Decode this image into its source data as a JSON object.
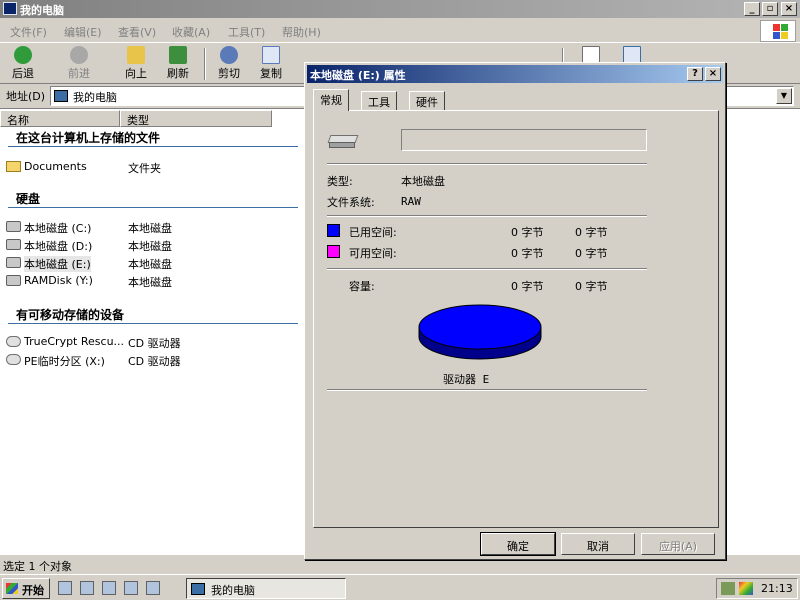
{
  "window": {
    "title": "我的电脑"
  },
  "menu": [
    "文件(F)",
    "编辑(E)",
    "查看(V)",
    "收藏(A)",
    "工具(T)",
    "帮助(H)"
  ],
  "toolbar": {
    "back": "后退",
    "forward": "前进",
    "up": "向上",
    "refresh": "刷新",
    "cut": "剪切",
    "copy": "复制"
  },
  "address": {
    "label": "地址(D)",
    "value": "我的电脑"
  },
  "list": {
    "columns": [
      "名称",
      "类型"
    ],
    "groups": [
      {
        "title": "在这台计算机上存储的文件",
        "items": [
          {
            "name": "Documents",
            "type": "文件夹",
            "icon": "folder-icon"
          }
        ]
      },
      {
        "title": "硬盘",
        "items": [
          {
            "name": "本地磁盘 (C:)",
            "type": "本地磁盘",
            "icon": "hard-disk-icon"
          },
          {
            "name": "本地磁盘 (D:)",
            "type": "本地磁盘",
            "icon": "hard-disk-icon"
          },
          {
            "name": "本地磁盘 (E:)",
            "type": "本地磁盘",
            "icon": "hard-disk-icon"
          },
          {
            "name": "RAMDisk (Y:)",
            "type": "本地磁盘",
            "icon": "hard-disk-icon"
          }
        ]
      },
      {
        "title": "有可移动存储的设备",
        "items": [
          {
            "name": "TrueCrypt Rescu...",
            "type": "CD 驱动器",
            "icon": "cd-drive-icon"
          },
          {
            "name": "PE临时分区 (X:)",
            "type": "CD 驱动器",
            "icon": "cd-drive-icon"
          }
        ]
      }
    ]
  },
  "status": {
    "text": "选定 1 个对象"
  },
  "taskbar": {
    "start": "开始",
    "task": "我的电脑",
    "clock": "21:13"
  },
  "dialog": {
    "title": "本地磁盘 (E:) 属性",
    "tabs": [
      "常规",
      "工具",
      "硬件"
    ],
    "type_label": "类型:",
    "type_value": "本地磁盘",
    "fs_label": "文件系统:",
    "fs_value": "RAW",
    "used_label": "已用空间:",
    "used_bytes": "0 字节",
    "used_size": "0 字节",
    "free_label": "可用空间:",
    "free_bytes": "0 字节",
    "free_size": "0 字节",
    "capacity_label": "容量:",
    "capacity_bytes": "0 字节",
    "capacity_size": "0 字节",
    "drive_caption": "驱动器 E",
    "ok": "确定",
    "cancel": "取消",
    "apply": "应用(A)",
    "colors": {
      "used": "#0000ff",
      "free": "#ff00ff",
      "pie": "#0000ff"
    }
  }
}
